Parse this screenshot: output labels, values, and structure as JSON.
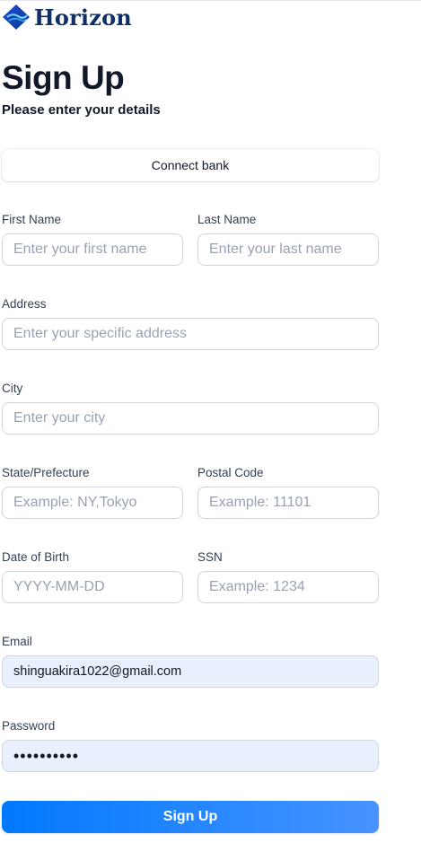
{
  "brand": {
    "name": "Horizon",
    "logo_icon": "horizon-logo-icon",
    "color": "#0f2f66"
  },
  "header": {
    "title": "Sign Up",
    "subtitle": "Please enter your details"
  },
  "connect_bank": {
    "label": "Connect bank"
  },
  "fields": {
    "first_name": {
      "label": "First Name",
      "placeholder": "Enter your first name",
      "value": ""
    },
    "last_name": {
      "label": "Last Name",
      "placeholder": "Enter your last name",
      "value": ""
    },
    "address": {
      "label": "Address",
      "placeholder": "Enter your specific address",
      "value": ""
    },
    "city": {
      "label": "City",
      "placeholder": "Enter your city",
      "value": ""
    },
    "state": {
      "label": "State/Prefecture",
      "placeholder": "Example: NY,Tokyo",
      "value": ""
    },
    "postal_code": {
      "label": "Postal Code",
      "placeholder": "Example: 11101",
      "value": ""
    },
    "dob": {
      "label": "Date of Birth",
      "placeholder": "YYYY-MM-DD",
      "value": ""
    },
    "ssn": {
      "label": "SSN",
      "placeholder": "Example: 1234",
      "value": ""
    },
    "email": {
      "label": "Email",
      "value": "shinguakira1022@gmail.com"
    },
    "password": {
      "label": "Password",
      "value": "••••••••••"
    }
  },
  "submit": {
    "label": "Sign Up"
  },
  "colors": {
    "accent_start": "#0179fe",
    "accent_end": "#4893ff",
    "autofill_bg": "#e8f0fe"
  }
}
